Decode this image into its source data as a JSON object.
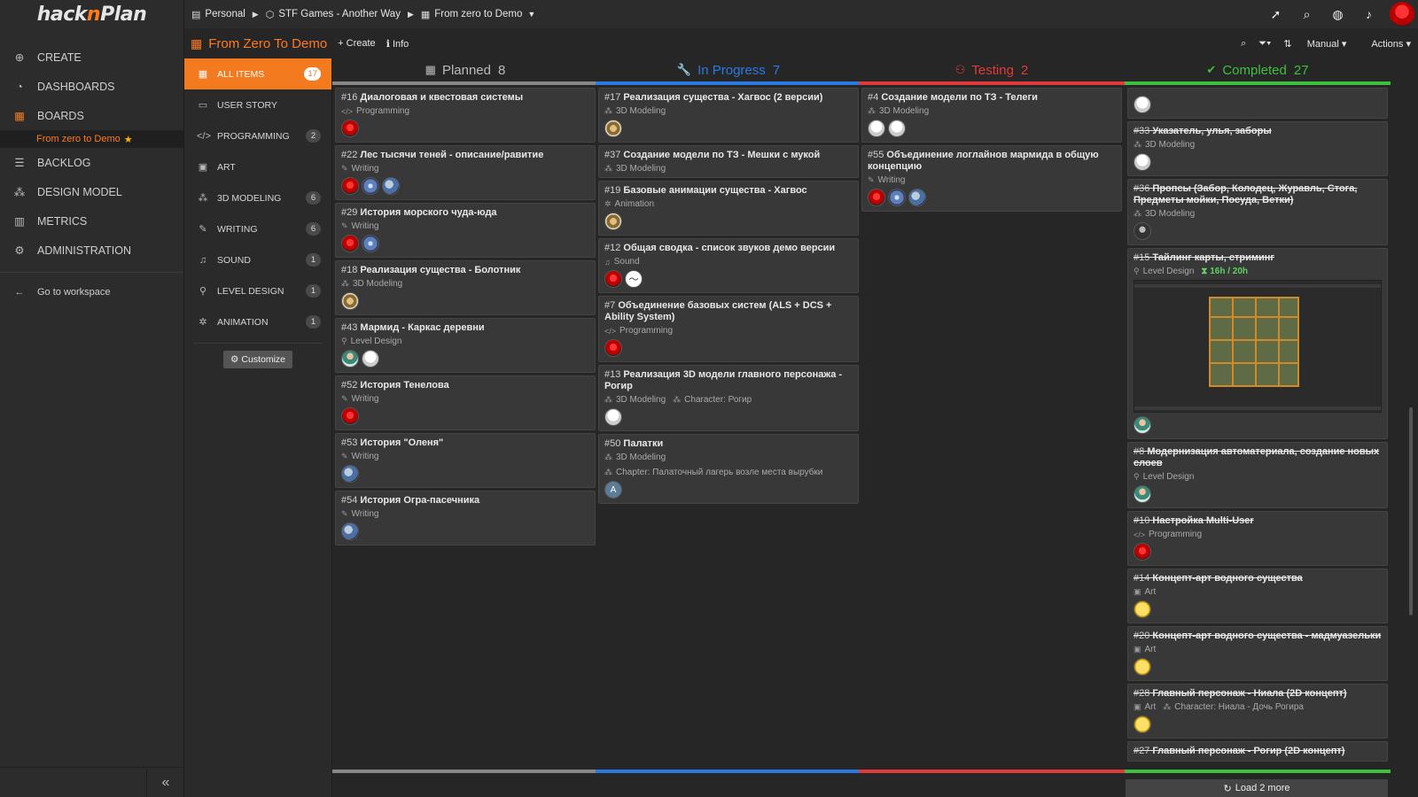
{
  "app": {
    "logo_text_a": "hack",
    "logo_text_b": "n",
    "logo_text_c": "Plan"
  },
  "sidebar": {
    "items": [
      {
        "label": "CREATE",
        "icon": "plus-circle-icon"
      },
      {
        "label": "DASHBOARDS",
        "icon": "dashboard-icon"
      },
      {
        "label": "BOARDS",
        "icon": "boards-icon"
      },
      {
        "label": "BACKLOG",
        "icon": "list-icon"
      },
      {
        "label": "DESIGN MODEL",
        "icon": "sitemap-icon"
      },
      {
        "label": "METRICS",
        "icon": "bar-chart-icon"
      },
      {
        "label": "ADMINISTRATION",
        "icon": "gear-icon"
      }
    ],
    "sub_item": "From zero to Demo",
    "goto": "Go to workspace"
  },
  "breadcrumb": {
    "workspace": "Personal",
    "project": "STF Games - Another Way",
    "board": "From zero to Demo"
  },
  "subbar": {
    "title": "From Zero To Demo",
    "create": "Create",
    "info": "Info",
    "manual": "Manual",
    "actions": "Actions"
  },
  "filters": {
    "items": [
      {
        "label": "ALL ITEMS",
        "count": "17",
        "icon": "grid-icon"
      },
      {
        "label": "USER STORY",
        "count": "",
        "icon": "story-icon"
      },
      {
        "label": "PROGRAMMING",
        "count": "2",
        "icon": "code-icon"
      },
      {
        "label": "ART",
        "count": "",
        "icon": "image-icon"
      },
      {
        "label": "3D MODELING",
        "count": "6",
        "icon": "cubes-icon"
      },
      {
        "label": "WRITING",
        "count": "6",
        "icon": "pencil-icon"
      },
      {
        "label": "SOUND",
        "count": "1",
        "icon": "headphones-icon"
      },
      {
        "label": "LEVEL DESIGN",
        "count": "1",
        "icon": "map-pin-icon"
      },
      {
        "label": "ANIMATION",
        "count": "1",
        "icon": "animation-icon"
      }
    ],
    "customize": "Customize"
  },
  "colors": {
    "accent": "#f47a20",
    "planned": "#888888",
    "in_progress": "#2a7ae2",
    "testing": "#e03a3a",
    "completed": "#3fbf3f"
  },
  "columns": [
    {
      "title": "Planned",
      "count": "8",
      "icon": "calendar-icon",
      "color": "#888888",
      "cards": [
        {
          "id": "#16",
          "title": "Диалоговая и квестовая системы",
          "cat": "Programming",
          "cat_icon": "</>",
          "avatars": [
            "red"
          ]
        },
        {
          "id": "#22",
          "title": "Лес тысячи теней - описание/равитие",
          "cat": "Writing",
          "cat_icon": "✎",
          "avatars": [
            "red",
            "blue",
            "globe"
          ]
        },
        {
          "id": "#29",
          "title": "История морского чуда-юда",
          "cat": "Writing",
          "cat_icon": "✎",
          "avatars": [
            "red",
            "blue"
          ]
        },
        {
          "id": "#18",
          "title": "Реализация существа - Болотник",
          "cat": "3D Modeling",
          "cat_icon": "⁂",
          "avatars": [
            "horse"
          ]
        },
        {
          "id": "#43",
          "title": "Мармид - Каркас деревни",
          "cat": "Level Design",
          "cat_icon": "⚲",
          "avatars": [
            "person",
            "white"
          ]
        },
        {
          "id": "#52",
          "title": "История Тенелова",
          "cat": "Writing",
          "cat_icon": "✎",
          "avatars": [
            "red"
          ]
        },
        {
          "id": "#53",
          "title": "История \"Оленя\"",
          "cat": "Writing",
          "cat_icon": "✎",
          "avatars": [
            "globe"
          ]
        },
        {
          "id": "#54",
          "title": "История Огра-пасечника",
          "cat": "Writing",
          "cat_icon": "✎",
          "avatars": [
            "globe"
          ]
        }
      ]
    },
    {
      "title": "In Progress",
      "count": "7",
      "icon": "wrench-icon",
      "color": "#2a7ae2",
      "cards": [
        {
          "id": "#17",
          "title": "Реализация существа - Хагвос (2 версии)",
          "cat": "3D Modeling",
          "cat_icon": "⁂",
          "avatars": [
            "horse"
          ]
        },
        {
          "id": "#37",
          "title": "Создание модели по ТЗ - Мешки с мукой",
          "cat": "3D Modeling",
          "cat_icon": "⁂",
          "avatars": []
        },
        {
          "id": "#19",
          "title": "Базовые анимации существа - Хагвос",
          "cat": "Animation",
          "cat_icon": "✲",
          "avatars": [
            "horse"
          ]
        },
        {
          "id": "#12",
          "title": "Общая сводка - список звуков демо версии",
          "cat": "Sound",
          "cat_icon": "♫",
          "avatars": [
            "red",
            "wave"
          ]
        },
        {
          "id": "#7",
          "title": "Объединение базовых систем (ALS + DCS + Ability System)",
          "cat": "Programming",
          "cat_icon": "</>",
          "avatars": [
            "red"
          ]
        },
        {
          "id": "#13",
          "title": "Реализация 3D модели главного персонажа - Рогир",
          "cat": "3D Modeling",
          "cat_icon": "⁂",
          "extra": "Character: Рогир",
          "avatars": [
            "white"
          ]
        },
        {
          "id": "#50",
          "title": "Палатки",
          "cat": "3D Modeling",
          "cat_icon": "⁂",
          "extra_line": "Chapter: Палаточный лагерь возле места вырубки",
          "avatars": [
            "letter"
          ]
        }
      ]
    },
    {
      "title": "Testing",
      "count": "2",
      "icon": "gamepad-icon",
      "color": "#e03a3a",
      "cards": [
        {
          "id": "#4",
          "title": "Создание модели по ТЗ - Телеги",
          "cat": "3D Modeling",
          "cat_icon": "⁂",
          "avatars": [
            "white",
            "white"
          ]
        },
        {
          "id": "#55",
          "title": "Объединение логлайнов мармида в общую концепцию",
          "cat": "Writing",
          "cat_icon": "✎",
          "avatars": [
            "red",
            "blue",
            "globe"
          ]
        }
      ]
    },
    {
      "title": "Completed",
      "count": "27",
      "icon": "check-icon",
      "color": "#3fbf3f",
      "cards": [
        {
          "id": "",
          "title": "",
          "cat": "",
          "avatars": [
            "white"
          ],
          "partial": true
        },
        {
          "id": "#33",
          "title": "Указатель, улья, заборы",
          "cat": "3D Modeling",
          "cat_icon": "⁂",
          "avatars": [
            "white"
          ]
        },
        {
          "id": "#36",
          "title": "Пропсы (Забор, Колодец, Журавль, Стога, Предметы мойки, Посуда, Ветки)",
          "cat": "3D Modeling",
          "cat_icon": "⁂",
          "avatars": [
            "dark"
          ]
        },
        {
          "id": "#15",
          "title": "Тайлинг карты, стриминг",
          "cat": "Level Design",
          "cat_icon": "⚲",
          "timer": "16h / 20h",
          "avatars": [
            "person"
          ],
          "thumb": true
        },
        {
          "id": "#8",
          "title": "Модернизация автоматериала, создание новых слоев",
          "cat": "Level Design",
          "cat_icon": "⚲",
          "avatars": [
            "person"
          ]
        },
        {
          "id": "#10",
          "title": "Настройка Multi-User",
          "cat": "Programming",
          "cat_icon": "</>",
          "avatars": [
            "red"
          ]
        },
        {
          "id": "#14",
          "title": "Концепт-арт водного существа",
          "cat": "Art",
          "cat_icon": "▣",
          "avatars": [
            "yellow"
          ]
        },
        {
          "id": "#20",
          "title": "Концепт-арт водного существа - мадмуазельки",
          "cat": "Art",
          "cat_icon": "▣",
          "avatars": [
            "yellow"
          ]
        },
        {
          "id": "#28",
          "title": "Главный персонаж - Ниала (2D концепт)",
          "cat": "Art",
          "cat_icon": "▣",
          "extra": "Character: Ниала - Дочь Рогира",
          "avatars": [
            "yellow"
          ]
        },
        {
          "id": "#27",
          "title": "Главный персонаж - Рогир (2D концепт)",
          "cat": "",
          "avatars": []
        }
      ]
    }
  ],
  "load_more": "Load 2 more"
}
